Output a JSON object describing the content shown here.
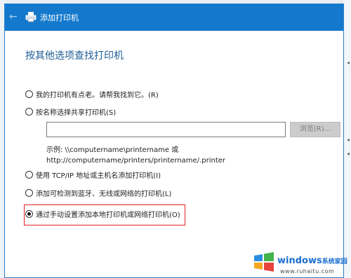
{
  "window": {
    "title": "添加打印机"
  },
  "heading": "按其他选项查找打印机",
  "options": [
    {
      "label": "我的打印机有点老。请帮我找到它。(R)",
      "checked": false
    },
    {
      "label": "按名称选择共享打印机(S)",
      "checked": false
    },
    {
      "label": "使用 TCP/IP 地址或主机名添加打印机(I)",
      "checked": false
    },
    {
      "label": "添加可检测到蓝牙、无线或网络的打印机(L)",
      "checked": false
    },
    {
      "label": "通过手动设置添加本地打印机或网络打印机(O)",
      "checked": true
    }
  ],
  "share_input": {
    "value": ""
  },
  "browse_button": "浏览(R)...",
  "example": {
    "line1": "示例: \\\\computername\\printername 或",
    "line2": "http://computername/printers/printername/.printer"
  },
  "watermark": {
    "brand": "windows",
    "brand_cn": "系统家园",
    "sub": "www.ruhaitu.com"
  },
  "colors": {
    "titlebar": "#1479cc",
    "heading": "#1e5c94",
    "highlight_border": "#e02020"
  }
}
